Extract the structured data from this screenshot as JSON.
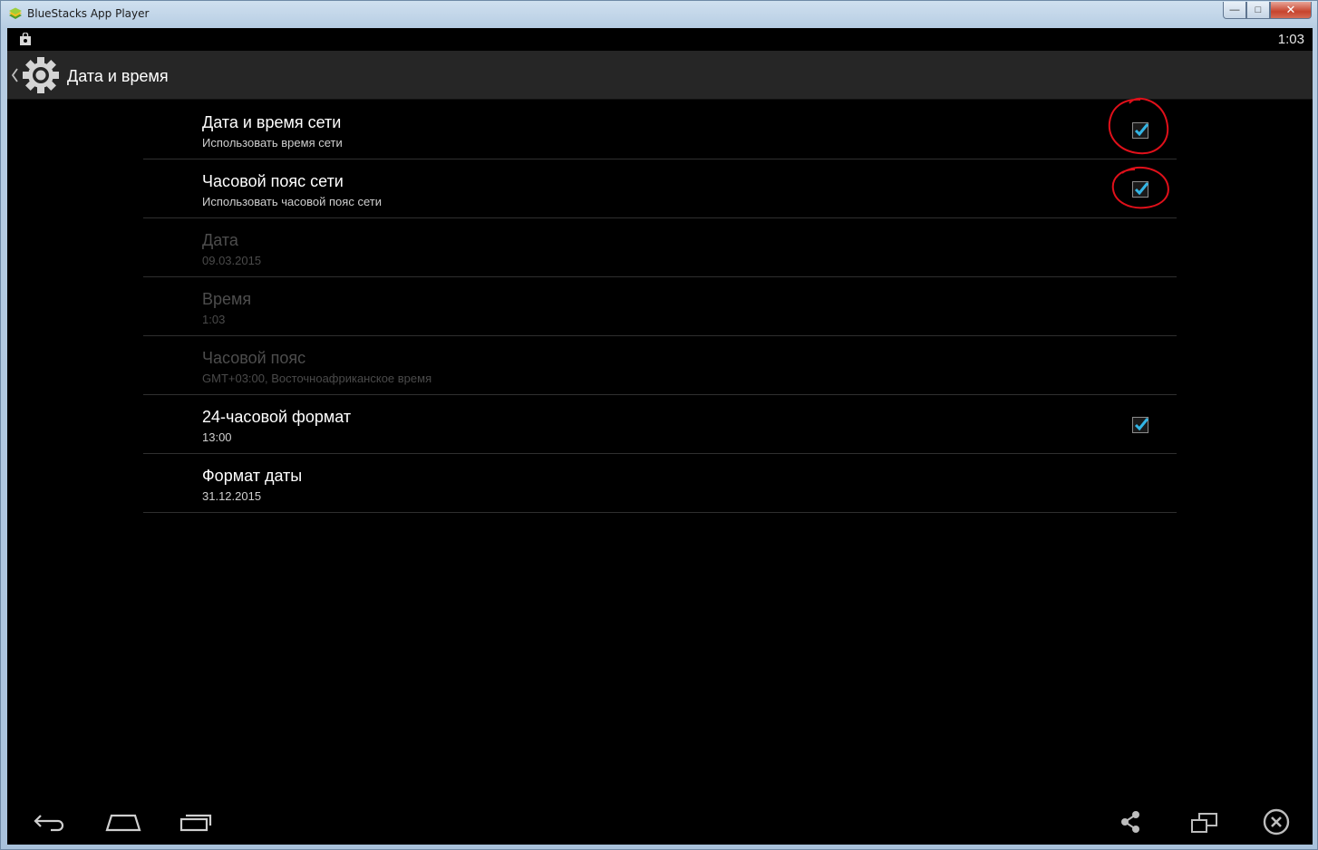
{
  "window": {
    "title": "BlueStacks App Player",
    "controls": {
      "minimize": "—",
      "maximize": "□",
      "close": "✕"
    }
  },
  "statusbar": {
    "time": "1:03"
  },
  "actionbar": {
    "title": "Дата и время"
  },
  "settings": [
    {
      "title": "Дата и время сети",
      "summary": "Использовать время сети"
    },
    {
      "title": "Часовой пояс сети",
      "summary": "Использовать часовой пояс сети"
    },
    {
      "title": "Дата",
      "summary": "09.03.2015"
    },
    {
      "title": "Время",
      "summary": "1:03"
    },
    {
      "title": "Часовой пояс",
      "summary": "GMT+03:00, Восточноафриканское время"
    },
    {
      "title": "24-часовой формат",
      "summary": "13:00"
    },
    {
      "title": "Формат даты",
      "summary": "31.12.2015"
    }
  ],
  "colors": {
    "accent_check": "#33b5e5",
    "annotation": "#e0101a",
    "actionbar": "#262626"
  },
  "icons": {
    "app_logo": "bluestacks-logo-icon",
    "status_bag": "shopping-bag-icon",
    "back": "chevron-left-icon",
    "settings": "gear-icon",
    "nav_back": "back-arrow-icon",
    "nav_home": "home-icon",
    "nav_recents": "recent-apps-icon",
    "share": "share-icon",
    "multiwindow": "multi-window-icon",
    "close": "close-circle-icon"
  }
}
